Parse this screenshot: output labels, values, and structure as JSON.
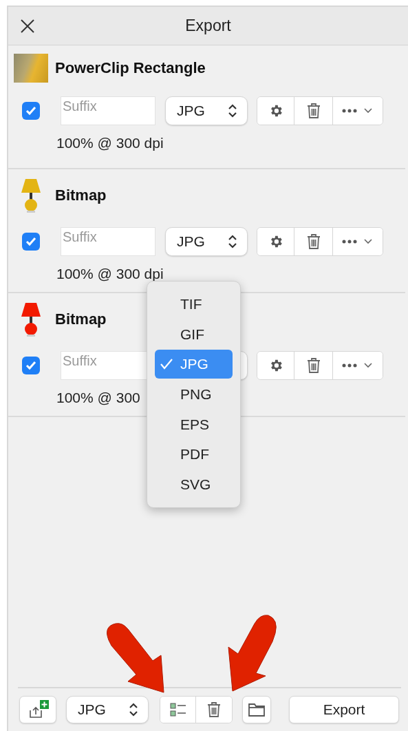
{
  "window": {
    "title": "Export"
  },
  "items": [
    {
      "name": "PowerClip Rectangle",
      "kind": "photo",
      "checked": true,
      "suffix_placeholder": "Suffix",
      "format": "JPG",
      "size": "100% @ 300 dpi"
    },
    {
      "name": "Bitmap",
      "kind": "lamp",
      "color": "#e3b414",
      "checked": true,
      "suffix_placeholder": "Suffix",
      "format": "JPG",
      "size": "100% @ 300 dpi"
    },
    {
      "name": "Bitmap",
      "kind": "lamp",
      "color": "#f21a00",
      "checked": true,
      "suffix_placeholder": "Suffix",
      "size": "100% @ 300"
    }
  ],
  "format_menu": {
    "items": [
      {
        "label": "TIF",
        "selected": false
      },
      {
        "label": "GIF",
        "selected": false
      },
      {
        "label": "JPG",
        "selected": true
      },
      {
        "label": "PNG",
        "selected": false
      },
      {
        "label": "EPS",
        "selected": false
      },
      {
        "label": "PDF",
        "selected": false
      },
      {
        "label": "SVG",
        "selected": false
      }
    ]
  },
  "footer": {
    "format": "JPG",
    "export_button": "Export"
  }
}
